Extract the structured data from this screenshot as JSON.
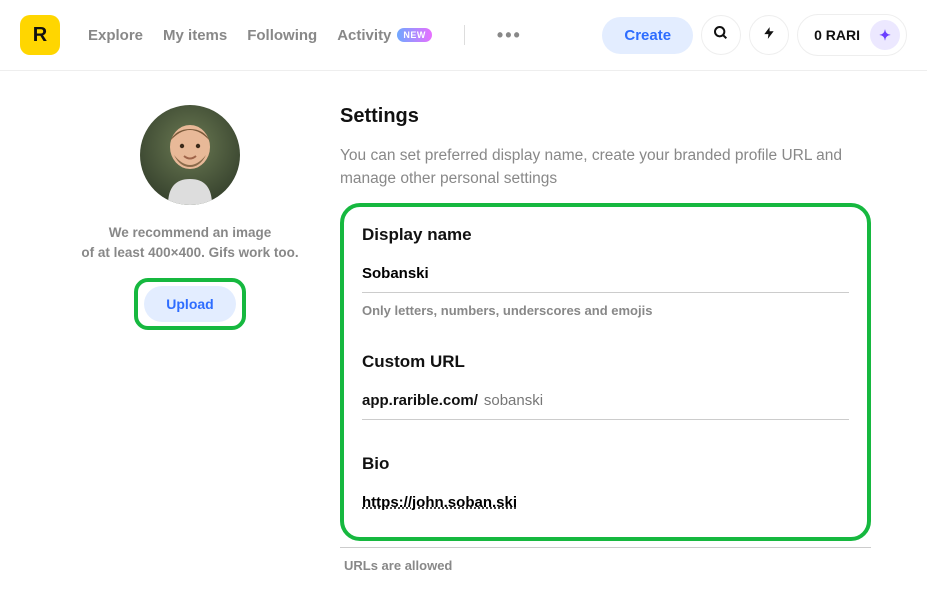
{
  "header": {
    "logo_letter": "R",
    "nav": {
      "explore": "Explore",
      "my_items": "My items",
      "following": "Following",
      "activity": "Activity",
      "new_badge": "NEW"
    },
    "create_label": "Create",
    "rari_balance": "0 RARI"
  },
  "sidebar": {
    "rec_line1": "We recommend an image",
    "rec_line2": "of at least 400×400. Gifs work too.",
    "upload_label": "Upload"
  },
  "settings": {
    "title": "Settings",
    "desc": "You can set preferred display name, create your branded profile URL and manage other personal settings",
    "display_name": {
      "label": "Display name",
      "value": "Sobanski",
      "hint": "Only letters, numbers, underscores and emojis"
    },
    "custom_url": {
      "label": "Custom URL",
      "prefix": "app.rarible.com/",
      "value": "sobanski"
    },
    "bio": {
      "label": "Bio",
      "value": "https://john.soban.ski",
      "hint": "URLs are allowed"
    }
  }
}
